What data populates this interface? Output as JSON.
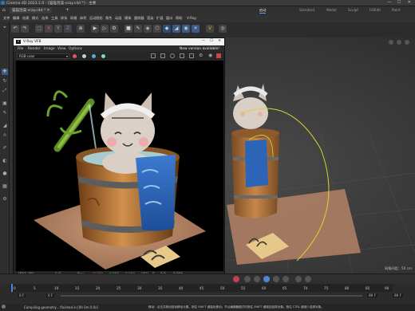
{
  "window": {
    "title": "Cinema 4D 2023.1.0 - [猫猫泡澡-vray.c4d *] - 主要"
  },
  "tabs": [
    {
      "label": "猫猫泡澡-vray.c4d *"
    }
  ],
  "menus": [
    "文件",
    "编辑",
    "创建",
    "模式",
    "选择",
    "工具",
    "样条",
    "网格",
    "体积",
    "运动图形",
    "角色",
    "动画",
    "模拟",
    "跟踪器",
    "渲染",
    "扩展",
    "窗口",
    "帮助",
    "V-Ray"
  ],
  "layouts": [
    {
      "label": "启动",
      "active": true
    },
    {
      "label": "Standard"
    },
    {
      "label": "Model"
    },
    {
      "label": "Sculpt"
    },
    {
      "label": "UVEdit"
    },
    {
      "label": "Paint"
    }
  ],
  "viewport": {
    "menus": [
      "查看",
      "摄像机",
      "显示",
      "选项",
      "过滤",
      "面板"
    ],
    "grid_label": "网格间距：50 cm",
    "curve_color": "#d6d62e"
  },
  "vfb": {
    "title": "V-Ray VFB",
    "menus": [
      "File",
      "Render",
      "Image",
      "View",
      "Options"
    ],
    "version_notice": "New version available!",
    "channel": "RGB color",
    "coords": "[597, 90]",
    "mode": "1x1",
    "raw_label": "Raw",
    "values": [
      "0.000",
      "0.000",
      "0.000"
    ],
    "hsv": "HSV",
    "hsv_values": [
      "0",
      "0.0",
      "0.000"
    ]
  },
  "timeline": {
    "frame_current": "0 F",
    "frame_start": "0 F",
    "frame_end": "90 F",
    "frame_end2": "90 F",
    "ticks": [
      "0",
      "5",
      "10",
      "15",
      "20",
      "25",
      "30",
      "35",
      "40",
      "45",
      "50",
      "55",
      "60",
      "65",
      "70",
      "75",
      "80",
      "85",
      "90"
    ]
  },
  "status": {
    "message": "Compiling geometry... finished in [0h 0m 0.0s]",
    "hint": "移动：点击并拖动鼠标移动元素。按住 SHIFT 键量化移动；节点编辑器模式时按住 SHIFT 键增加选择对象；按住 CTRL 键减少选择对象。"
  },
  "colors": {
    "accent": "#3c5a86",
    "vfb_title_bg": "#f2f2f2",
    "render_bg": "#000000",
    "timeline_marker": "#4f87d8"
  }
}
